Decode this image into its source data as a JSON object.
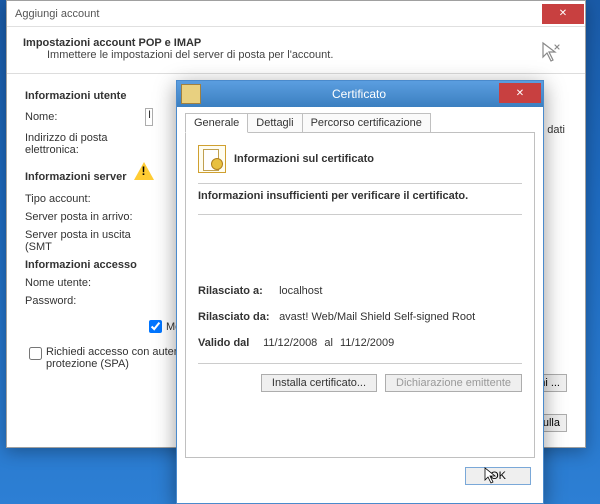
{
  "back": {
    "title": "Aggiungi account",
    "header_bold": "Impostazioni account POP e IMAP",
    "header_sub": "Immettere le impostazioni del server di posta per l'account.",
    "sections": {
      "user": "Informazioni utente",
      "server": "Informazioni server",
      "access": "Informazioni accesso"
    },
    "labels": {
      "name": "Nome:",
      "email": "Indirizzo di posta elettronica:",
      "account_type": "Tipo account:",
      "incoming": "Server posta in arrivo:",
      "outgoing": "Server posta in uscita (SMT",
      "username": "Nome utente:",
      "password": "Password:"
    },
    "input_prefix": "I",
    "remember_pw": "Memo",
    "spa_label": "Richiedi accesso con autentica protezione (SPA)",
    "side_text": "che i dati",
    "more_settings_btn": "tazioni ...",
    "cancel_btn": "Annulla"
  },
  "front": {
    "title": "Certificato",
    "tabs": {
      "general": "Generale",
      "details": "Dettagli",
      "path": "Percorso certificazione"
    },
    "cert_heading": "Informazioni sul certificato",
    "cert_warning": "Informazioni insufficienti per verificare il certificato.",
    "issued_to_lbl": "Rilasciato a:",
    "issued_to": "localhost",
    "issued_by_lbl": "Rilasciato da:",
    "issued_by": "avast! Web/Mail Shield Self-signed Root",
    "valid_lbl": "Valido dal",
    "valid_from": "11/12/2008",
    "valid_sep": "al",
    "valid_to": "11/12/2009",
    "install_btn": "Installa certificato...",
    "issuer_btn": "Dichiarazione emittente",
    "ok_btn": "OK"
  }
}
